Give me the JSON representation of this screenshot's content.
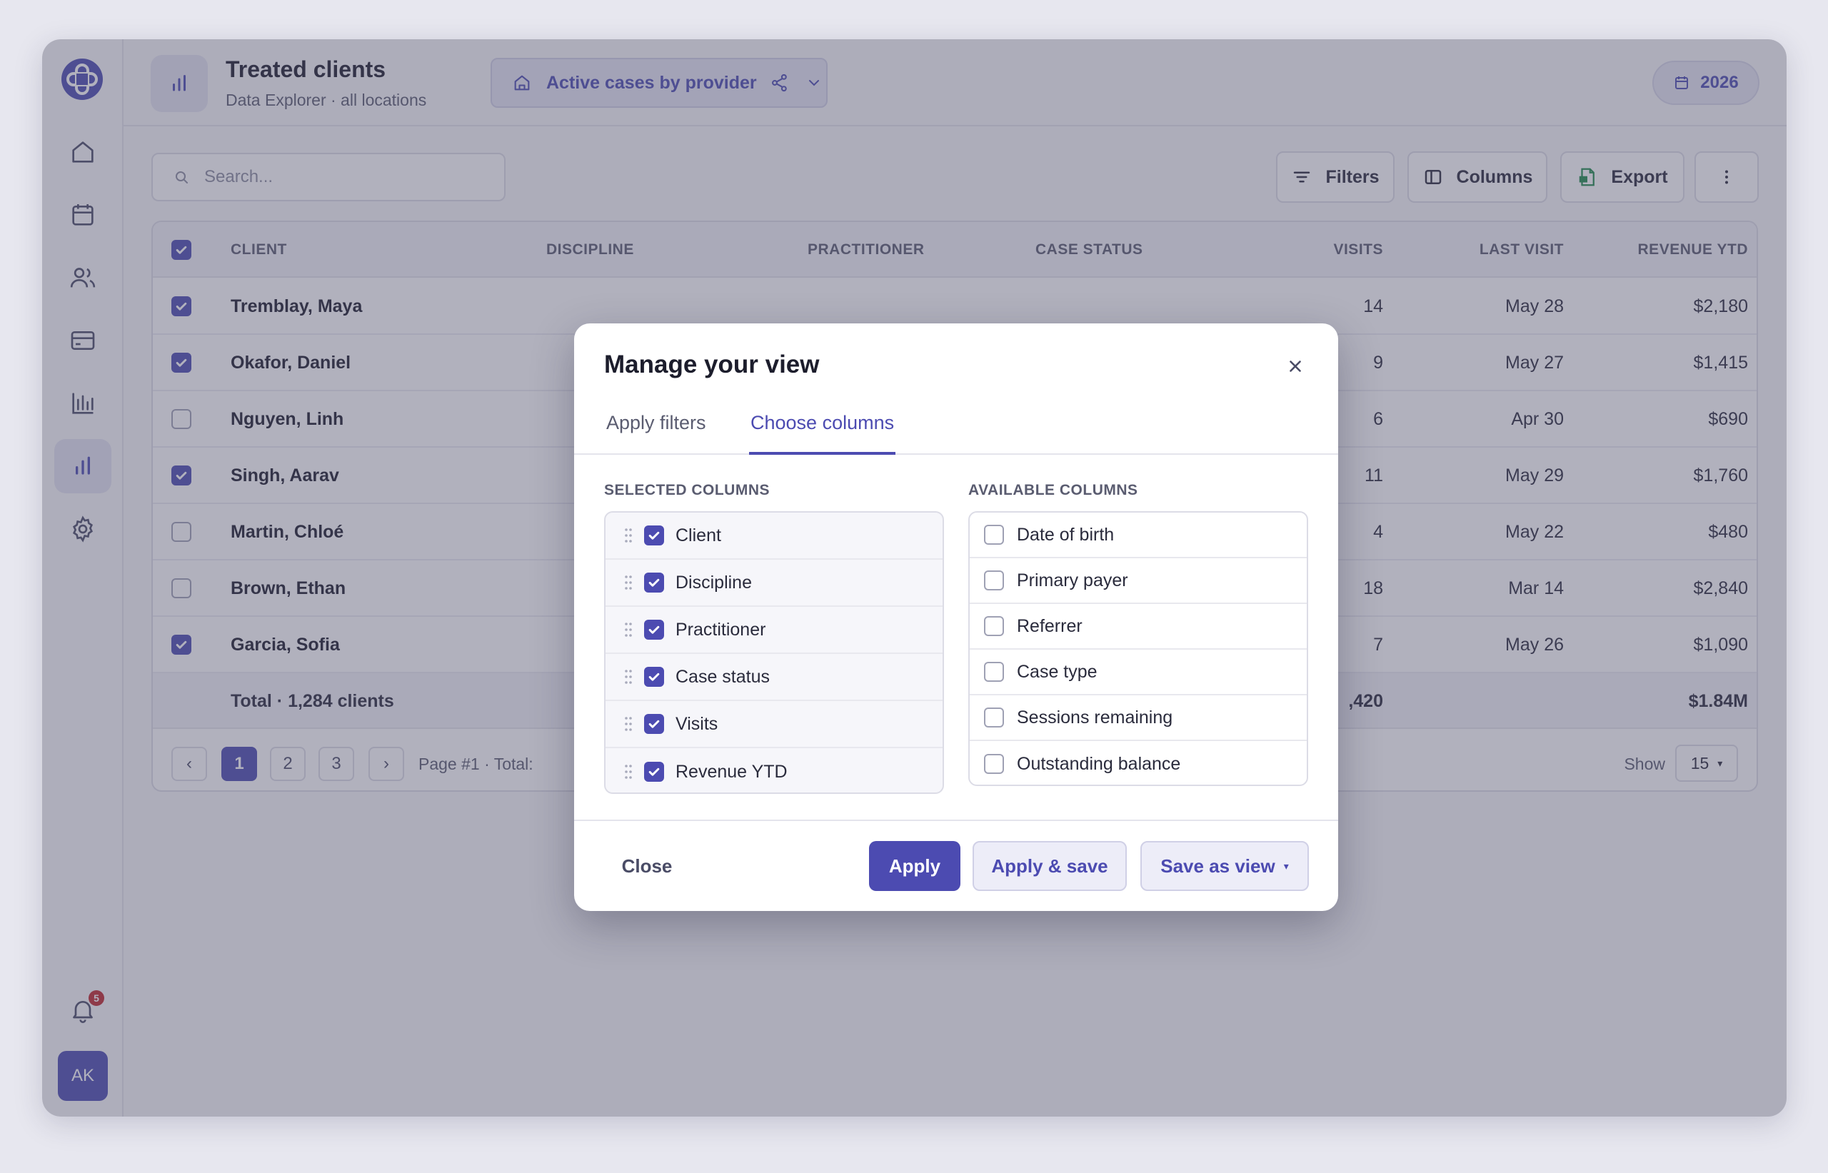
{
  "header": {
    "title": "Treated clients",
    "subtitle": "Data Explorer · all locations",
    "view_name": "Active cases by provider",
    "year": "2026"
  },
  "toolbar": {
    "search_placeholder": "Search...",
    "filters_label": "Filters",
    "columns_label": "Columns",
    "export_label": "Export"
  },
  "table": {
    "columns": [
      "CLIENT",
      "DISCIPLINE",
      "PRACTITIONER",
      "CASE STATUS",
      "VISITS",
      "LAST VISIT",
      "REVENUE YTD"
    ],
    "rows": [
      {
        "checked": true,
        "client": "Tremblay, Maya",
        "visits": "14",
        "last_visit": "May 28",
        "revenue": "$2,180"
      },
      {
        "checked": true,
        "client": "Okafor, Daniel",
        "visits": "9",
        "last_visit": "May 27",
        "revenue": "$1,415"
      },
      {
        "checked": false,
        "client": "Nguyen, Linh",
        "visits": "6",
        "last_visit": "Apr 30",
        "revenue": "$690"
      },
      {
        "checked": true,
        "client": "Singh, Aarav",
        "visits": "11",
        "last_visit": "May 29",
        "revenue": "$1,760"
      },
      {
        "checked": false,
        "client": "Martin, Chloé",
        "visits": "4",
        "last_visit": "May 22",
        "revenue": "$480"
      },
      {
        "checked": false,
        "client": "Brown, Ethan",
        "visits": "18",
        "last_visit": "Mar 14",
        "revenue": "$2,840"
      },
      {
        "checked": true,
        "client": "Garcia, Sofia",
        "visits": "7",
        "last_visit": "May 26",
        "revenue": "$1,090"
      }
    ],
    "total_label": "Total · 1,284 clients",
    "total_visits": ",420",
    "total_revenue": "$1.84M"
  },
  "pagination": {
    "prev": "‹",
    "pages": [
      "1",
      "2",
      "3"
    ],
    "next": "›",
    "info": "Page #1 · Total:",
    "show_label": "Show",
    "show_value": "15"
  },
  "notifications": {
    "count": "5"
  },
  "user": {
    "initials": "AK"
  },
  "modal": {
    "title": "Manage your view",
    "tabs": [
      "Apply filters",
      "Choose columns"
    ],
    "active_tab": "Choose columns",
    "selected_label": "SELECTED COLUMNS",
    "available_label": "AVAILABLE COLUMNS",
    "selected_columns": [
      "Client",
      "Discipline",
      "Practitioner",
      "Case status",
      "Visits",
      "Revenue YTD"
    ],
    "available_columns": [
      "Date of birth",
      "Primary payer",
      "Referrer",
      "Case type",
      "Sessions remaining",
      "Outstanding balance"
    ],
    "buttons": {
      "close": "Close",
      "apply": "Apply",
      "apply_save": "Apply & save",
      "save_view": "Save as view"
    }
  },
  "colors": {
    "accent": "#4c4bb1",
    "badge": "#c0272d",
    "export_icon": "#1f8a4c"
  }
}
